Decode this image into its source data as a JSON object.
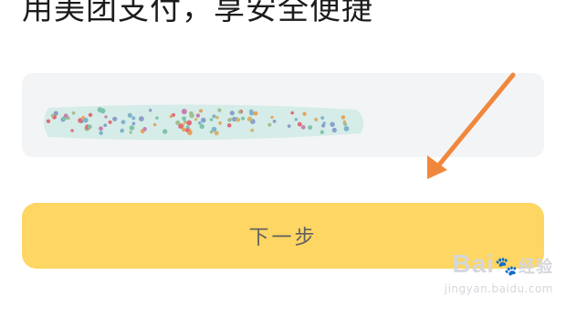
{
  "header": {
    "title": "用美团支付，享安全便捷"
  },
  "input_card": {
    "masked_value": "••••••••••••"
  },
  "next_button": {
    "label": "下一步"
  },
  "annotation": {
    "icon": "arrow-icon",
    "color": "#f0883c"
  },
  "watermark": {
    "brand": "Bai",
    "brand_suffix": "经验",
    "url": "jingyan.baidu.com"
  },
  "colors": {
    "button": "#fdd663",
    "card": "#f3f4f6",
    "button_text": "#5f5f5f"
  }
}
